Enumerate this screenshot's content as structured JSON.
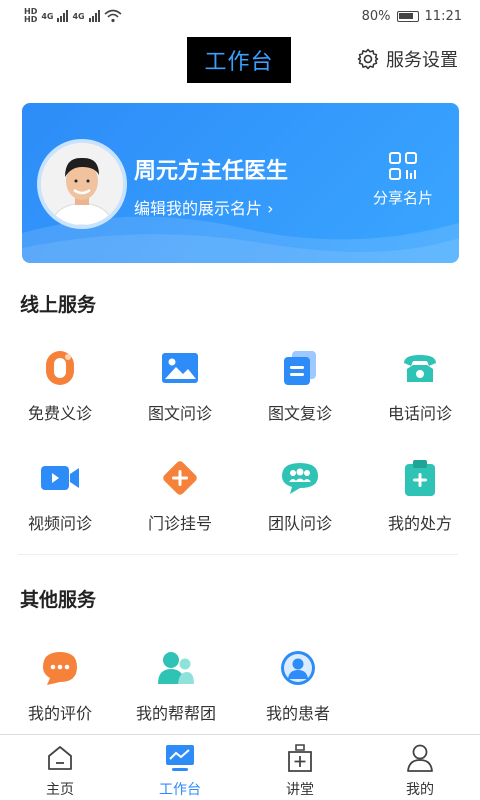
{
  "status_bar": {
    "battery": "80%",
    "time": "11:21",
    "network1": "4G",
    "network2": "4G"
  },
  "header": {
    "title": "工作台",
    "settings_label": "服务设置"
  },
  "profile": {
    "name": "周元方主任医生",
    "edit_label": "编辑我的展示名片 ›",
    "share_label": "分享名片"
  },
  "online_services": {
    "title": "线上服务",
    "items": [
      {
        "label": "免费义诊",
        "icon": "free-consult-icon"
      },
      {
        "label": "图文问诊",
        "icon": "image-text-consult-icon"
      },
      {
        "label": "图文复诊",
        "icon": "image-text-revisit-icon"
      },
      {
        "label": "电话问诊",
        "icon": "phone-consult-icon"
      },
      {
        "label": "视频问诊",
        "icon": "video-consult-icon"
      },
      {
        "label": "门诊挂号",
        "icon": "outpatient-register-icon"
      },
      {
        "label": "团队问诊",
        "icon": "team-consult-icon"
      },
      {
        "label": "我的处方",
        "icon": "prescription-icon"
      }
    ]
  },
  "other_services": {
    "title": "其他服务",
    "items": [
      {
        "label": "我的评价",
        "icon": "review-icon"
      },
      {
        "label": "我的帮帮团",
        "icon": "help-group-icon"
      },
      {
        "label": "我的患者",
        "icon": "patients-icon"
      }
    ]
  },
  "bottom_nav": {
    "items": [
      {
        "label": "主页",
        "icon": "home-icon"
      },
      {
        "label": "工作台",
        "icon": "workbench-icon"
      },
      {
        "label": "讲堂",
        "icon": "lecture-icon"
      },
      {
        "label": "我的",
        "icon": "profile-icon"
      }
    ],
    "active": "工作台"
  },
  "colors": {
    "accent": "#2d8cf8",
    "orange": "#f5813a",
    "teal": "#2fc3b5"
  }
}
